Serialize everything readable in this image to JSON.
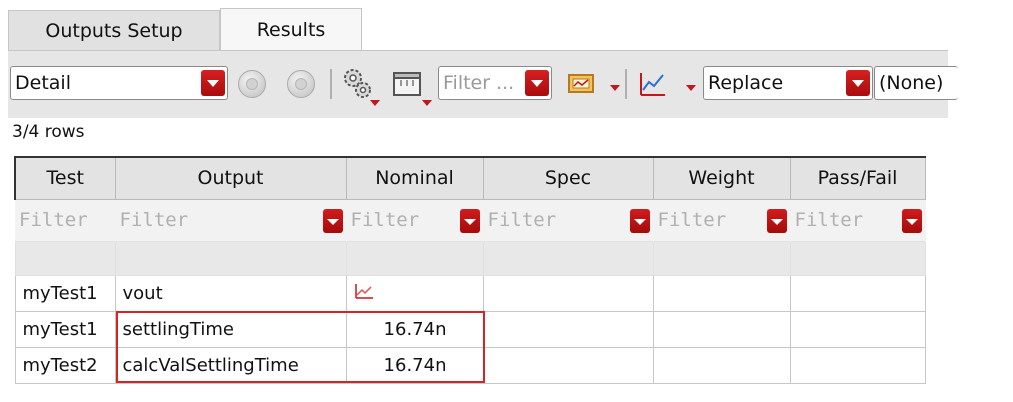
{
  "tabs": [
    {
      "label": "Outputs Setup"
    },
    {
      "label": "Results"
    }
  ],
  "toolbar": {
    "view_select": "Detail",
    "filter_placeholder": "Filter ...",
    "plot_mode": "Replace",
    "history": "(None)"
  },
  "status": {
    "rows": "3/4 rows"
  },
  "table": {
    "columns": [
      "Test",
      "Output",
      "Nominal",
      "Spec",
      "Weight",
      "Pass/Fail"
    ],
    "filter_placeholder": "Filter",
    "rows": [
      {
        "test": "myTest1",
        "output": "vout",
        "nominal": "",
        "nominal_icon": "waveform-icon",
        "spec": "",
        "weight": "",
        "pass_fail": ""
      },
      {
        "test": "myTest1",
        "output": "settlingTime",
        "nominal": "16.74n",
        "spec": "",
        "weight": "",
        "pass_fail": ""
      },
      {
        "test": "myTest2",
        "output": "calcValSettlingTime",
        "nominal": "16.74n",
        "spec": "",
        "weight": "",
        "pass_fail": ""
      }
    ]
  },
  "colors": {
    "accent": "#c4161c",
    "toolbar_bg": "#e6e6e6",
    "highlight": "#d72323"
  }
}
